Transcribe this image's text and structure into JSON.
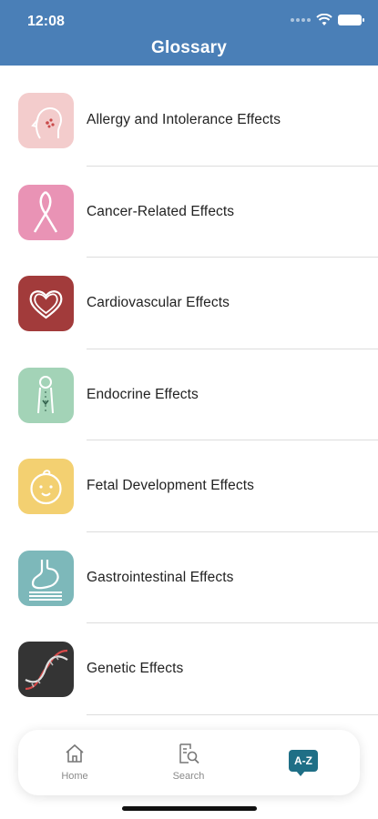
{
  "status": {
    "time": "12:08"
  },
  "header": {
    "title": "Glossary"
  },
  "items": [
    {
      "label": "Allergy and Intolerance Effects",
      "icon": "allergy-icon",
      "color": "#f1c9c9"
    },
    {
      "label": "Cancer-Related Effects",
      "icon": "ribbon-icon",
      "color": "#e890b2"
    },
    {
      "label": "Cardiovascular Effects",
      "icon": "heart-icon",
      "color": "#a13a3a"
    },
    {
      "label": "Endocrine Effects",
      "icon": "endocrine-icon",
      "color": "#9fd1b4"
    },
    {
      "label": "Fetal Development Effects",
      "icon": "baby-icon",
      "color": "#f2cf72"
    },
    {
      "label": "Gastrointestinal Effects",
      "icon": "stomach-icon",
      "color": "#7ab7b9"
    },
    {
      "label": "Genetic Effects",
      "icon": "dna-icon",
      "color": "#333333"
    }
  ],
  "tabs": [
    {
      "label": "Home",
      "icon": "home-icon"
    },
    {
      "label": "Search",
      "icon": "search-document-icon"
    },
    {
      "label": "A-Z",
      "icon": "az-icon",
      "active": true
    }
  ]
}
